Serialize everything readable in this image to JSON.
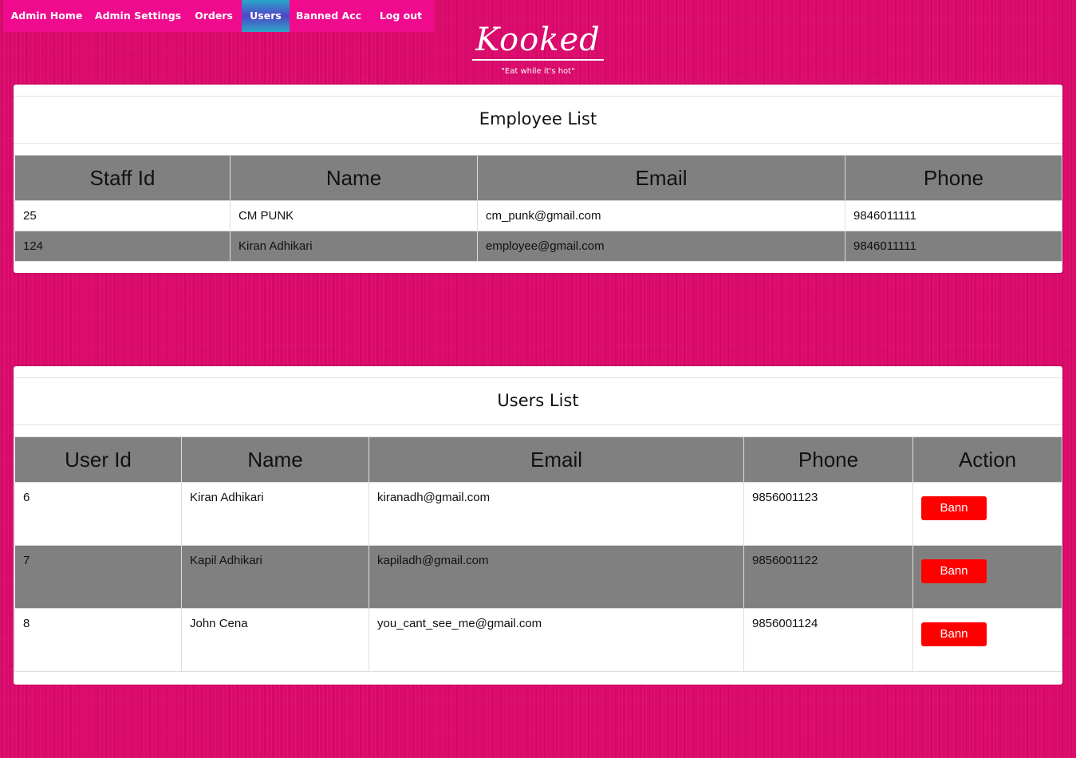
{
  "nav": {
    "items": [
      {
        "label": "Admin Home"
      },
      {
        "label": "Admin Settings"
      },
      {
        "label": "Orders"
      },
      {
        "label": "Users"
      },
      {
        "label": "Banned Acc"
      },
      {
        "label": "Log out"
      }
    ],
    "active": "Users"
  },
  "brand": {
    "name": "Kooked",
    "tagline": "\"Eat while it's hot\""
  },
  "employees": {
    "title": "Employee List",
    "columns": [
      "Staff Id",
      "Name",
      "Email",
      "Phone"
    ],
    "rows": [
      [
        "25",
        "CM PUNK",
        "cm_punk@gmail.com",
        "9846011111"
      ],
      [
        "124",
        "Kiran Adhikari",
        "employee@gmail.com",
        "9846011111"
      ]
    ]
  },
  "users": {
    "title": "Users List",
    "columns": [
      "User Id",
      "Name",
      "Email",
      "Phone",
      "Action"
    ],
    "action_label": "Bann",
    "rows": [
      [
        "6",
        "Kiran Adhikari",
        "kiranadh@gmail.com",
        "9856001123"
      ],
      [
        "7",
        "Kapil Adhikari",
        "kapiladh@gmail.com",
        "9856001122"
      ],
      [
        "8",
        "John Cena",
        "you_cant_see_me@gmail.com",
        "9856001124"
      ]
    ]
  },
  "colors": {
    "background": "#db0a6c",
    "navbar": "#f00b8e",
    "header_cell": "#808080",
    "ban_button": "#ff0000"
  }
}
